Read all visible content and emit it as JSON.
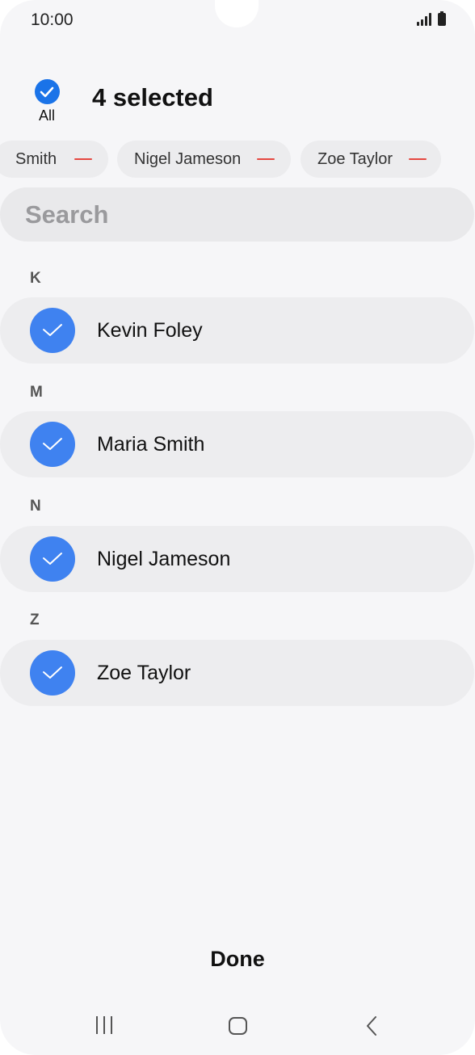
{
  "status": {
    "time": "10:00"
  },
  "header": {
    "all_label": "All",
    "title": "4 selected"
  },
  "chips": [
    {
      "label": "Smith"
    },
    {
      "label": "Nigel Jameson"
    },
    {
      "label": "Zoe Taylor"
    }
  ],
  "search": {
    "placeholder": "Search"
  },
  "sections": [
    {
      "letter": "K",
      "contacts": [
        {
          "name": "Kevin Foley"
        }
      ]
    },
    {
      "letter": "M",
      "contacts": [
        {
          "name": "Maria Smith"
        }
      ]
    },
    {
      "letter": "N",
      "contacts": [
        {
          "name": "Nigel Jameson"
        }
      ]
    },
    {
      "letter": "Z",
      "contacts": [
        {
          "name": "Zoe Taylor"
        }
      ]
    }
  ],
  "footer": {
    "done_label": "Done"
  },
  "colors": {
    "accent": "#1a73e8",
    "check": "#3f82f0",
    "remove": "#e5473f"
  },
  "icons": [
    "signal-icon",
    "battery-icon",
    "check-icon",
    "remove-icon",
    "recent-apps-icon",
    "home-icon",
    "back-icon"
  ]
}
